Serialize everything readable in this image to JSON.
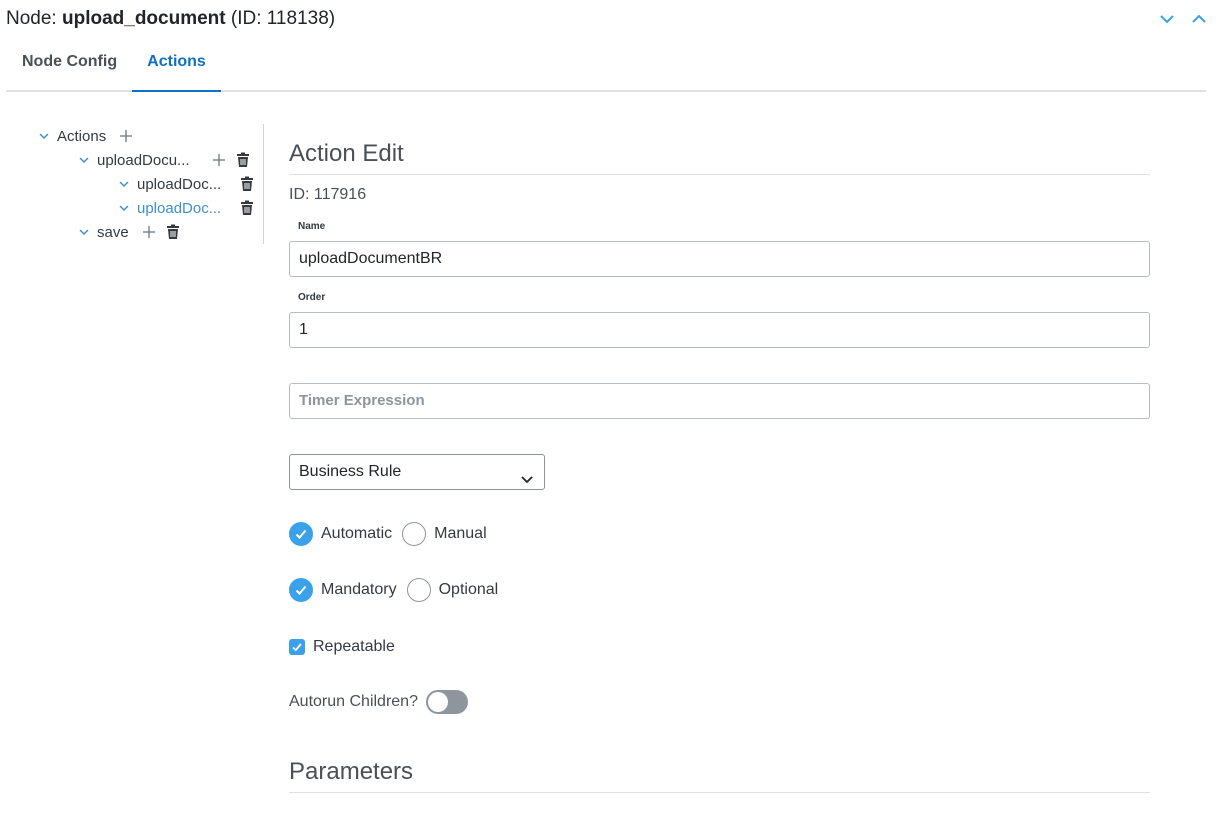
{
  "header": {
    "prefix": "Node: ",
    "node_name": "upload_document",
    "node_id_text": " (ID: 118138)",
    "icons": [
      "chevron-down-icon",
      "chevron-up-icon"
    ]
  },
  "tabs": [
    {
      "label": "Node Config",
      "active": false
    },
    {
      "label": "Actions",
      "active": true
    }
  ],
  "tree": {
    "root": "Actions",
    "items": [
      {
        "label": "uploadDocu...",
        "level": 1,
        "has_add": true,
        "has_delete": true,
        "active": false
      },
      {
        "label": "uploadDoc...",
        "level": 2,
        "has_add": false,
        "has_delete": true,
        "active": false
      },
      {
        "label": "uploadDoc...",
        "level": 2,
        "has_add": false,
        "has_delete": true,
        "active": true
      },
      {
        "label": "save",
        "level": 1,
        "has_add": true,
        "has_delete": true,
        "active": false
      }
    ]
  },
  "action_edit": {
    "title": "Action Edit",
    "id_text": "ID: 117916",
    "name_label": "Name",
    "name_value": "uploadDocumentBR",
    "order_label": "Order",
    "order_value": "1",
    "timer_placeholder": "Timer Expression",
    "timer_value": "",
    "type_value": "Business Rule",
    "trigger": {
      "options": [
        "Automatic",
        "Manual"
      ],
      "selected": "Automatic"
    },
    "requirement": {
      "options": [
        "Mandatory",
        "Optional"
      ],
      "selected": "Mandatory"
    },
    "repeatable_label": "Repeatable",
    "repeatable": true,
    "autorun_label": "Autorun Children?",
    "autorun": false
  },
  "parameters": {
    "title": "Parameters"
  },
  "colors": {
    "accent": "#0f6fc2",
    "checked": "#3ba1ea",
    "tree_active": "#3f8fcf"
  }
}
